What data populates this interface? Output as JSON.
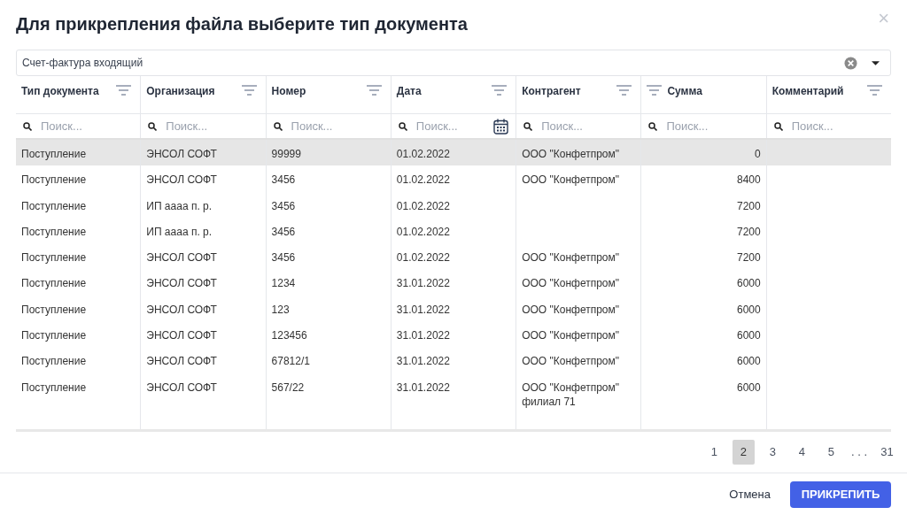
{
  "dialog": {
    "title": "Для прикрепления файла выберите тип документа",
    "close_icon": "×"
  },
  "document_type_select": {
    "value": "Счет-фактура входящий"
  },
  "table": {
    "columns": [
      {
        "label": "Тип документа",
        "kind": "text",
        "search_placeholder": "Поиск..."
      },
      {
        "label": "Организация",
        "kind": "text",
        "search_placeholder": "Поиск..."
      },
      {
        "label": "Номер",
        "kind": "text",
        "search_placeholder": "Поиск..."
      },
      {
        "label": "Дата",
        "kind": "date",
        "search_placeholder": "Поиск..."
      },
      {
        "label": "Контрагент",
        "kind": "text",
        "search_placeholder": "Поиск..."
      },
      {
        "label": "Сумма",
        "kind": "numeric",
        "search_placeholder": "Поиск..."
      },
      {
        "label": "Комментарий",
        "kind": "text",
        "search_placeholder": "Поиск..."
      }
    ],
    "rows": [
      {
        "selected": true,
        "cells": [
          "Поступление",
          "ЭНСОЛ СОФТ",
          "99999",
          "01.02.2022",
          "ООО \"Конфетпром\"",
          "0",
          ""
        ]
      },
      {
        "selected": false,
        "cells": [
          "Поступление",
          "ЭНСОЛ СОФТ",
          "3456",
          "01.02.2022",
          "ООО \"Конфетпром\"",
          "8400",
          ""
        ]
      },
      {
        "selected": false,
        "cells": [
          "Поступление",
          "ИП аааа п. р.",
          "3456",
          "01.02.2022",
          "",
          "7200",
          ""
        ]
      },
      {
        "selected": false,
        "cells": [
          "Поступление",
          "ИП аааа п. р.",
          "3456",
          "01.02.2022",
          "",
          "7200",
          ""
        ]
      },
      {
        "selected": false,
        "cells": [
          "Поступление",
          "ЭНСОЛ СОФТ",
          "3456",
          "01.02.2022",
          "ООО \"Конфетпром\"",
          "7200",
          ""
        ]
      },
      {
        "selected": false,
        "cells": [
          "Поступление",
          "ЭНСОЛ СОФТ",
          "1234",
          "31.01.2022",
          "ООО \"Конфетпром\"",
          "6000",
          ""
        ]
      },
      {
        "selected": false,
        "cells": [
          "Поступление",
          "ЭНСОЛ СОФТ",
          "123",
          "31.01.2022",
          "ООО \"Конфетпром\"",
          "6000",
          ""
        ]
      },
      {
        "selected": false,
        "cells": [
          "Поступление",
          "ЭНСОЛ СОФТ",
          "123456",
          "31.01.2022",
          "ООО \"Конфетпром\"",
          "6000",
          ""
        ]
      },
      {
        "selected": false,
        "cells": [
          "Поступление",
          "ЭНСОЛ СОФТ",
          "67812/1",
          "31.01.2022",
          "ООО \"Конфетпром\"",
          "6000",
          ""
        ]
      },
      {
        "selected": false,
        "cells": [
          "Поступление",
          "ЭНСОЛ СОФТ",
          "567/22",
          "31.01.2022",
          "ООО \"Конфетпром\" филиал 71",
          "6000",
          ""
        ]
      }
    ]
  },
  "pagination": [
    {
      "label": "1",
      "kind": "page",
      "selected": false
    },
    {
      "label": "2",
      "kind": "page",
      "selected": true
    },
    {
      "label": "3",
      "kind": "page",
      "selected": false
    },
    {
      "label": "4",
      "kind": "page",
      "selected": false
    },
    {
      "label": "5",
      "kind": "page",
      "selected": false
    },
    {
      "label": ". . .",
      "kind": "ellipsis"
    },
    {
      "label": "31",
      "kind": "page",
      "selected": false
    }
  ],
  "buttons": {
    "cancel": "Отмена",
    "attach": "ПРИКРЕПИТЬ"
  }
}
